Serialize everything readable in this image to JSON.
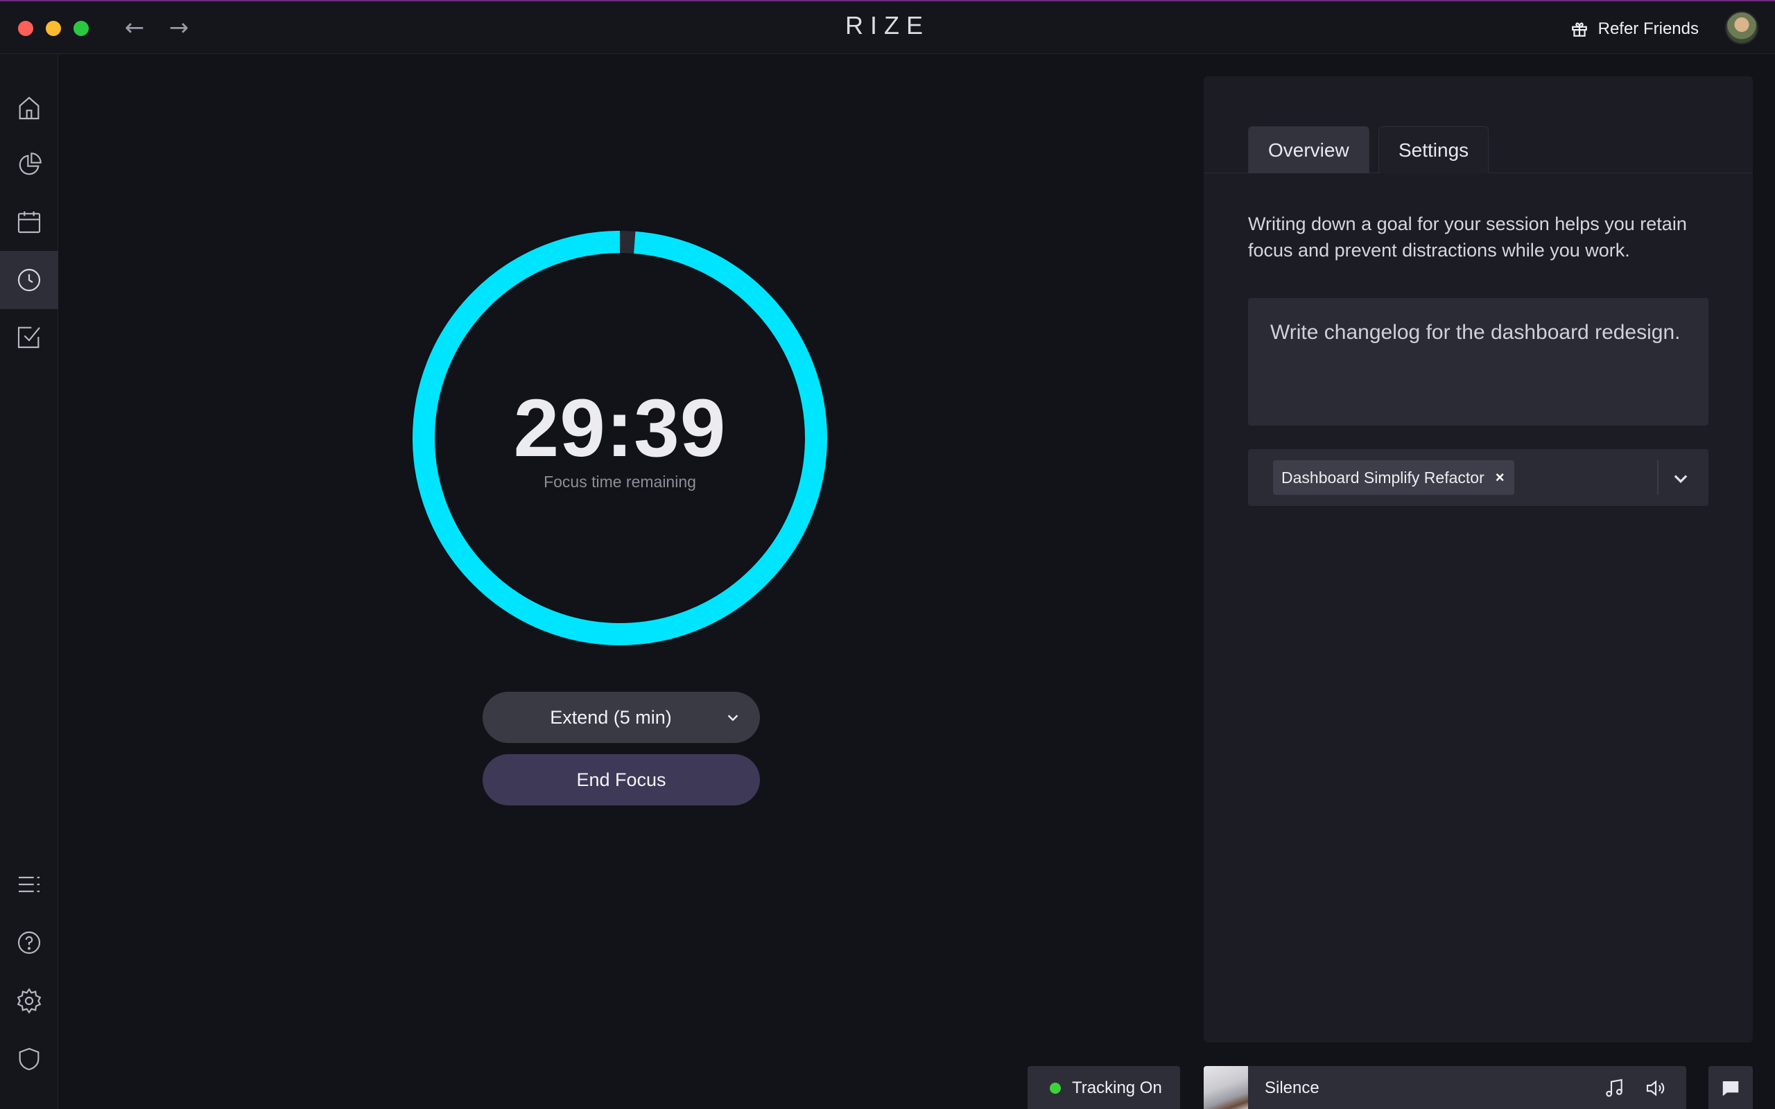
{
  "window": {
    "title": "RIZE",
    "refer_label": "Refer Friends"
  },
  "sidebar": {
    "top_items": [
      {
        "icon": "home-icon"
      },
      {
        "icon": "analytics-pie-icon"
      },
      {
        "icon": "calendar-icon"
      },
      {
        "icon": "clock-icon",
        "active": true
      },
      {
        "icon": "task-check-icon"
      }
    ],
    "bottom_items": [
      {
        "icon": "list-icon"
      },
      {
        "icon": "help-icon"
      },
      {
        "icon": "gear-icon"
      },
      {
        "icon": "shield-icon"
      }
    ]
  },
  "timer": {
    "time": "29:39",
    "caption": "Focus time remaining",
    "progress_remaining": 0.988,
    "ring_color": "#00e5ff"
  },
  "actions": {
    "extend_label": "Extend (5 min)",
    "end_label": "End Focus"
  },
  "panel": {
    "tabs": [
      {
        "label": "Overview",
        "active": true
      },
      {
        "label": "Settings",
        "active": false
      }
    ],
    "description": "Writing down a goal for your session helps you retain focus and prevent distractions while you work.",
    "goal_text": "Write changelog for the dashboard redesign.",
    "project_chip": "Dashboard Simplify Refactor",
    "chip_close": "×"
  },
  "status": {
    "tracking_label": "Tracking On",
    "tracking_color": "#3ed23a",
    "track_name": "Silence"
  },
  "colors": {
    "background": "#121219",
    "accent": "#00e5ff",
    "end_button": "#3e3956"
  }
}
